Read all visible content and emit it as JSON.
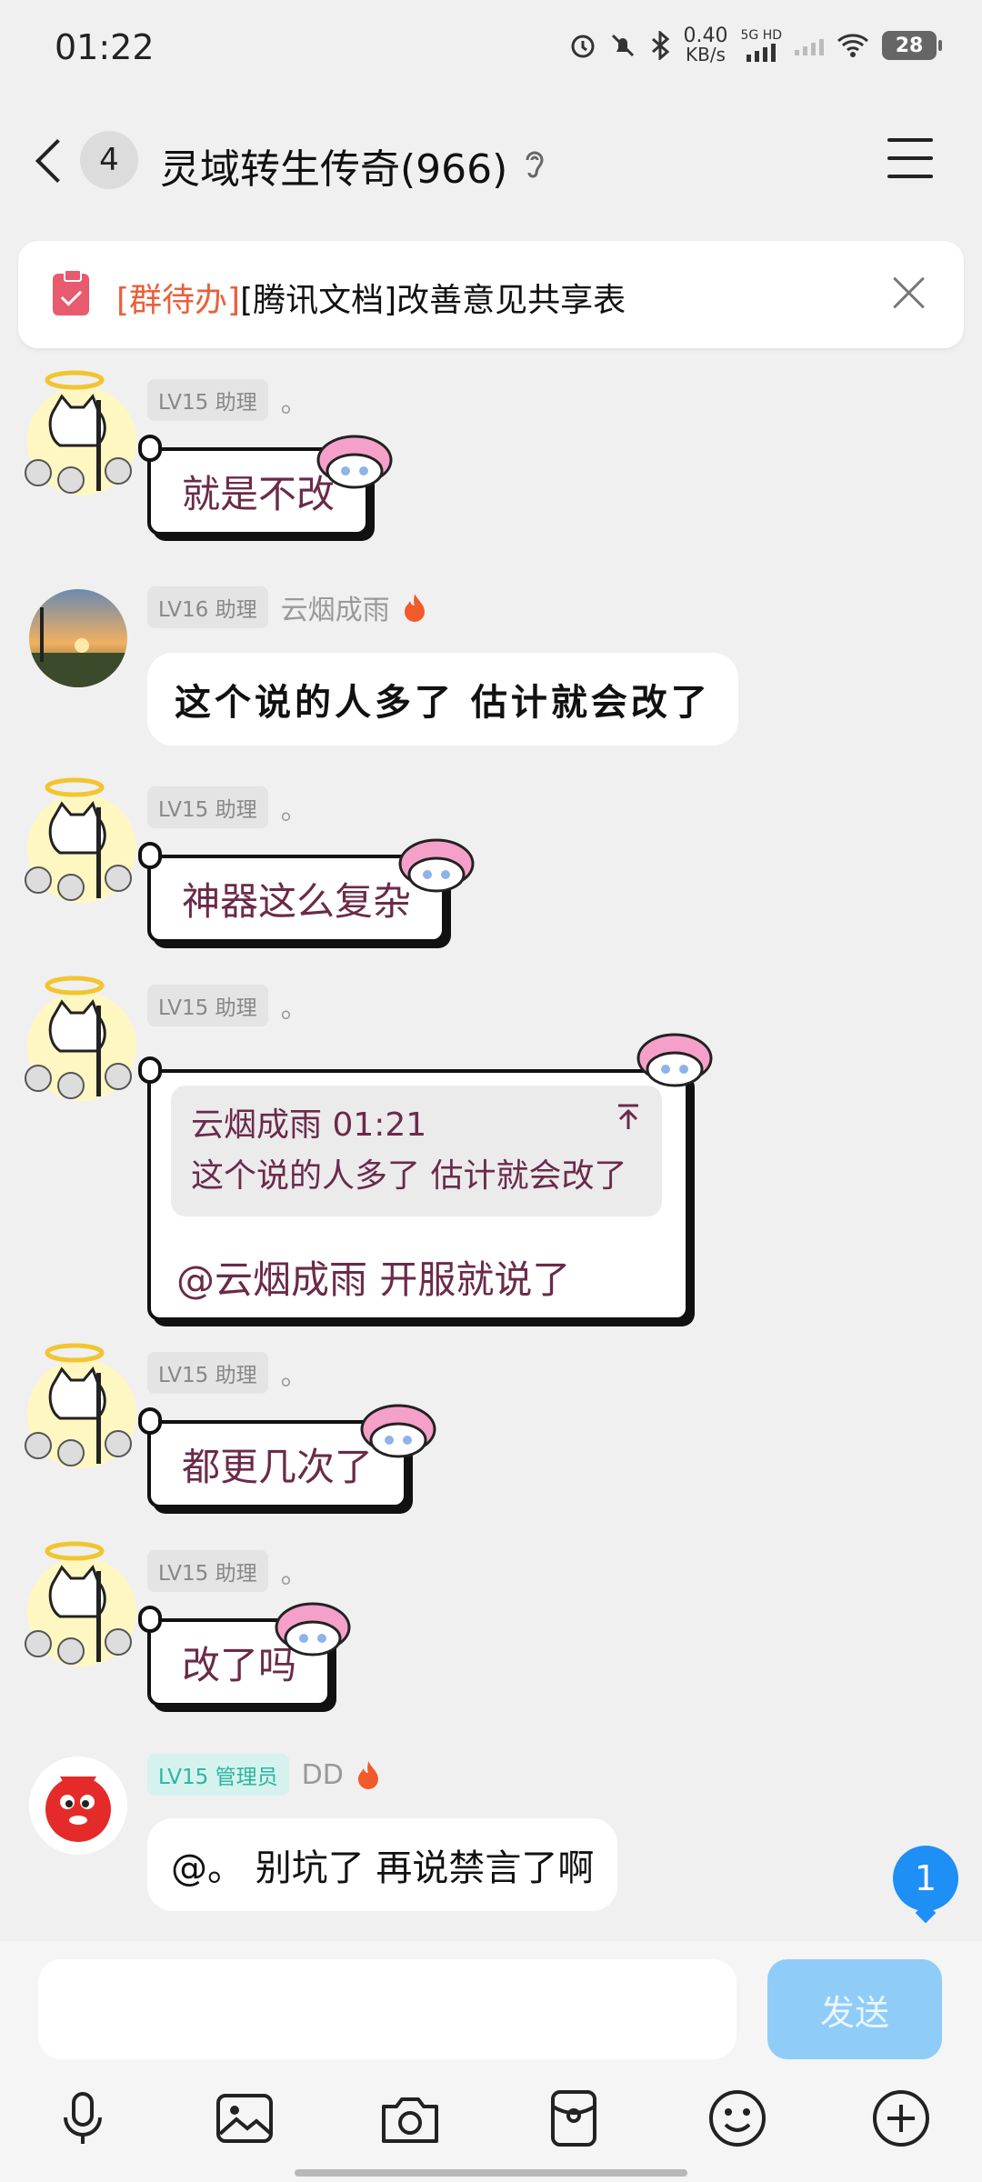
{
  "status_bar": {
    "time": "01:22",
    "net_speed_value": "0.40",
    "net_speed_unit": "KB/s",
    "network_label": "5G HD",
    "battery": "28",
    "icons": [
      "alarm-icon",
      "mute-icon",
      "bluetooth-icon",
      "signal-icon",
      "wifi-icon",
      "battery-icon"
    ]
  },
  "header": {
    "unread_count": "4",
    "title": "灵域转生传奇(966)",
    "icons": [
      "back-icon",
      "ear-icon",
      "menu-icon"
    ]
  },
  "todo": {
    "tag": "[群待办]",
    "text": "[腾讯文档]改善意见共享表"
  },
  "messages": [
    {
      "level": "LV15 助理",
      "name": "。",
      "text": "就是不改"
    },
    {
      "level": "LV16 助理",
      "name": "云烟成雨",
      "text": "这个说的人多了 估计就会改了"
    },
    {
      "level": "LV15 助理",
      "name": "。",
      "text": "神器这么复杂"
    },
    {
      "level": "LV15 助理",
      "name": "。",
      "quote_header": "云烟成雨 01:21",
      "quote_text": "这个说的人多了 估计就会改了",
      "text": "@云烟成雨 开服就说了"
    },
    {
      "level": "LV15 助理",
      "name": "。",
      "text": "都更几次了"
    },
    {
      "level": "LV15 助理",
      "name": "。",
      "text": "改了吗"
    },
    {
      "level": "LV15 管理员",
      "name": "DD",
      "text": "@。 别坑了 再说禁言了啊"
    }
  ],
  "unread_float": "1",
  "input": {
    "placeholder": "",
    "send_label": "发送"
  },
  "toolbar": [
    "microphone-icon",
    "image-icon",
    "camera-icon",
    "red-packet-icon",
    "emoji-icon",
    "plus-icon"
  ],
  "colors": {
    "accent_blue": "#1e8ff5",
    "send_disabled": "#8fcdf8",
    "todo_tag": "#e8603a",
    "cat_bubble_text": "#6b2a4a",
    "admin_badge": "#2bb6a0"
  }
}
